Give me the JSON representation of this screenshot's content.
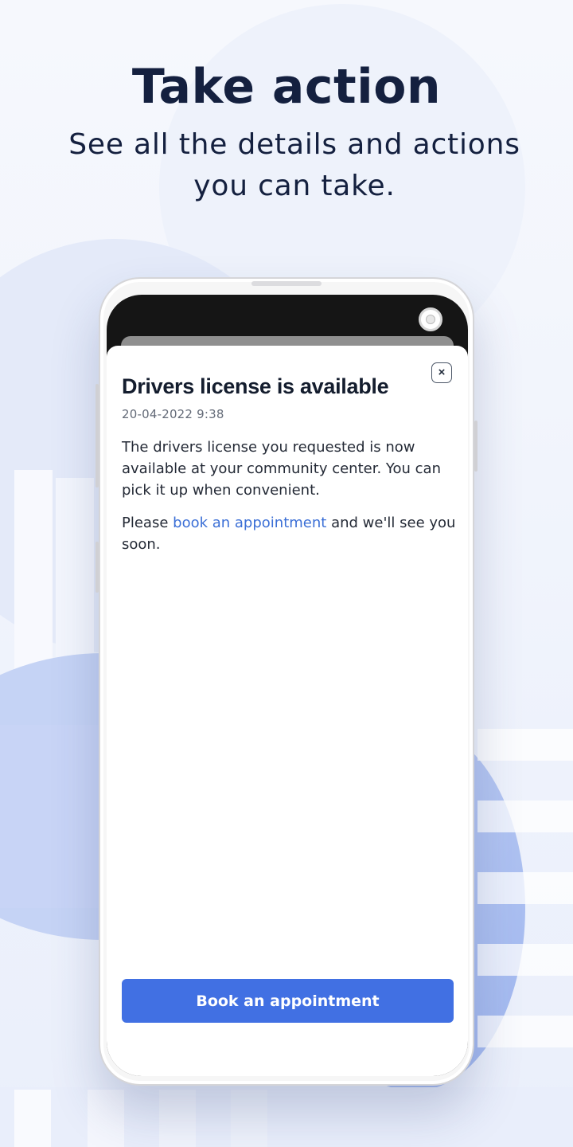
{
  "promo": {
    "headline": "Take action",
    "subheadline": "See all the details and actions you can take."
  },
  "notification": {
    "title": "Drivers license is available",
    "timestamp": "20-04-2022 9:38",
    "paragraph1": "The drivers license you requested is now available at your community center. You can pick it up when convenient.",
    "paragraph2_before": "Please ",
    "paragraph2_link": "book an appointment",
    "paragraph2_after": " and we'll see you soon.",
    "close_label": "×",
    "cta_label": "Book an appointment"
  },
  "colors": {
    "primary": "#4170e3",
    "link": "#3b6fd6",
    "heading": "#14203f",
    "background": "#f1f4fc"
  },
  "icons": {
    "close": "close-icon",
    "camera": "front-camera"
  }
}
